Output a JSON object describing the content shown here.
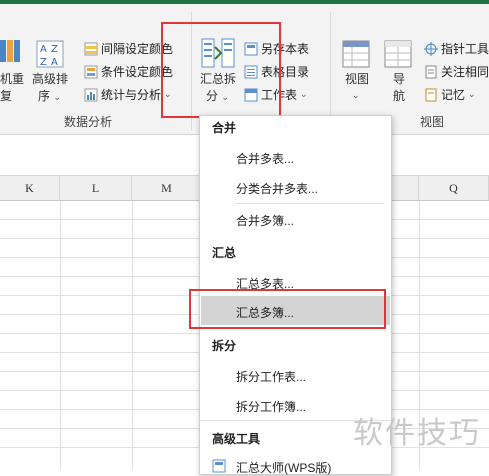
{
  "ribbon": {
    "left_partial_1": "机重",
    "left_partial_2": "复",
    "sort_label_1": "高级排",
    "sort_label_2": "序",
    "interval_color": "间隔设定颜色",
    "cond_color": "条件设定颜色",
    "stats": "统计与分析",
    "group_data_analysis": "数据分析",
    "summarize_label_1": "汇总拆",
    "summarize_label_2": "分",
    "save_copy": "另存本表",
    "table_dir": "表格目录",
    "workbook": "工作表",
    "view_label": "视图",
    "nav_label_1": "导",
    "nav_label_2": "航",
    "pointer_tool": "指针工具",
    "follow_same": "关注相同",
    "memo": "记忆",
    "group_view": "视图"
  },
  "columns": [
    "K",
    "L",
    "M",
    "P",
    "Q"
  ],
  "menu": {
    "sec_merge": "合并",
    "merge_sheets": "合并多表...",
    "class_merge": "分类合并多表...",
    "merge_books": "合并多簿...",
    "sec_sum": "汇总",
    "sum_sheets": "汇总多表...",
    "sum_books": "汇总多簿...",
    "sec_split": "拆分",
    "split_sheet": "拆分工作表...",
    "split_book": "拆分工作簿...",
    "sec_adv": "高级工具",
    "master": "汇总大师(WPS版)"
  },
  "watermark": "软件技巧",
  "colors": {
    "accent": "#217346",
    "highlight_box": "#e0383a"
  }
}
